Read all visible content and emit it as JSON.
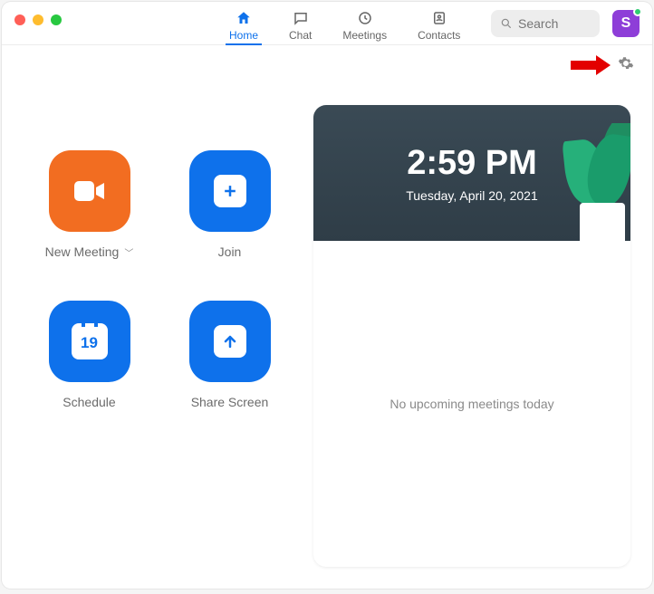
{
  "tabs": {
    "home": "Home",
    "chat": "Chat",
    "meetings": "Meetings",
    "contacts": "Contacts"
  },
  "search": {
    "placeholder": "Search"
  },
  "avatar": {
    "initial": "S"
  },
  "actions": {
    "new_meeting": "New Meeting",
    "join": "Join",
    "schedule": "Schedule",
    "share_screen": "Share Screen",
    "schedule_day": "19"
  },
  "panel": {
    "time": "2:59 PM",
    "date": "Tuesday, April 20, 2021",
    "empty": "No upcoming meetings today"
  }
}
